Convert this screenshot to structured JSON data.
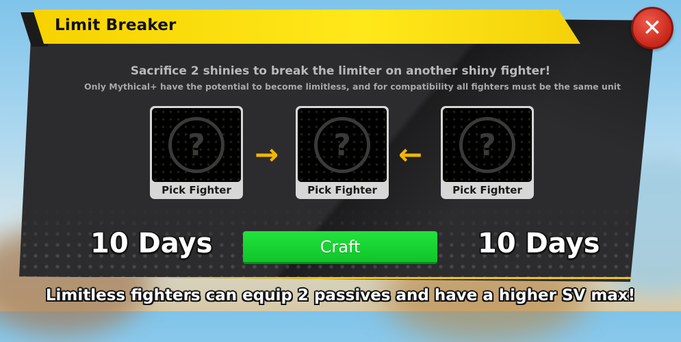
{
  "header": {
    "title": "Limit Breaker",
    "close_symbol": "✕"
  },
  "description": {
    "line1": "Sacrifice 2 shinies to break the limiter on another shiny fighter!",
    "line2": "Only Mythical+ have the potential to become limitless, and for compatibility all fighters must be the same unit"
  },
  "slots": [
    {
      "label": "Pick Fighter",
      "placeholder": "?"
    },
    {
      "label": "Pick Fighter",
      "placeholder": "?"
    },
    {
      "label": "Pick Fighter",
      "placeholder": "?"
    }
  ],
  "arrows": {
    "left": "→",
    "right": "←"
  },
  "timers": {
    "left": "10 Days",
    "right": "10 Days"
  },
  "craft": {
    "label": "Craft"
  },
  "footer": {
    "text": "Limitless fighters can equip 2 passives and have a higher SV max!"
  },
  "colors": {
    "accent_yellow": "#f6d200",
    "craft_green": "#16d430",
    "close_red": "#d8322a",
    "panel": "#2c2c2e"
  }
}
